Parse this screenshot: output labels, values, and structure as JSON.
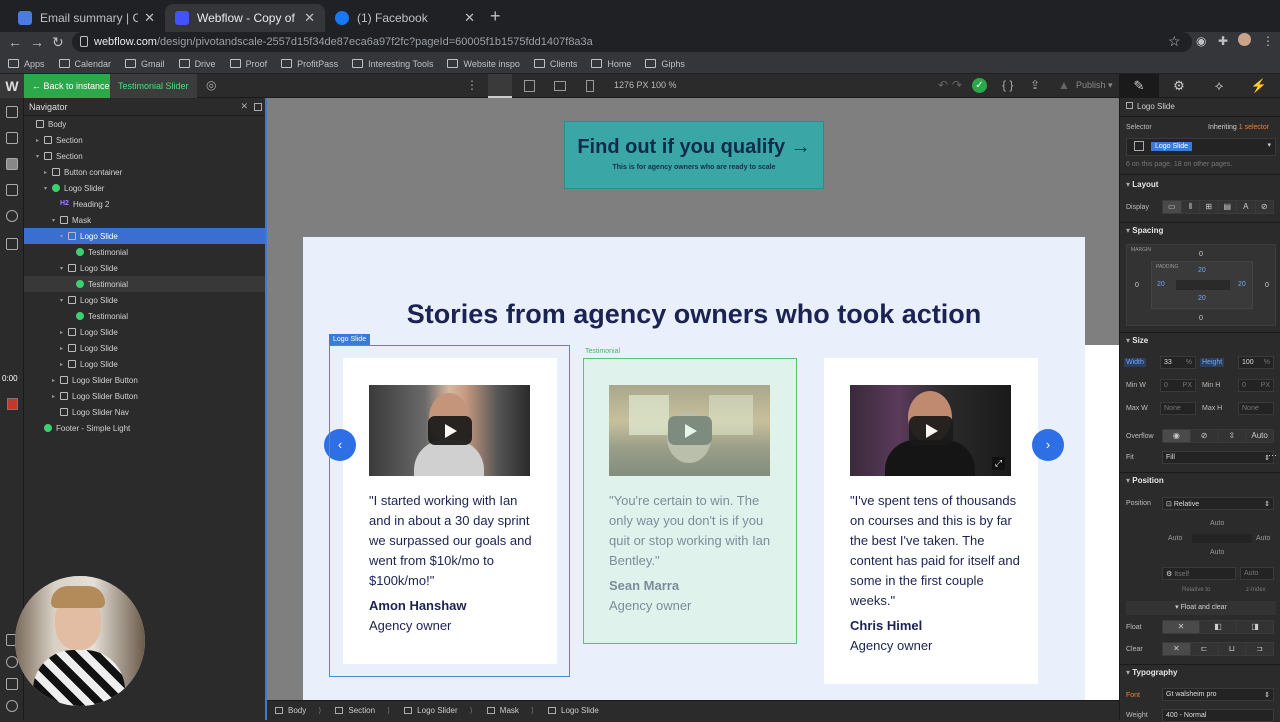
{
  "browser": {
    "tabs": [
      {
        "title": "Email summary | Conversion A",
        "favicon_color": "#4a7ce0"
      },
      {
        "title": "Webflow - Copy of Pivot and S",
        "favicon_color": "#4353ff"
      },
      {
        "title": "(1) Facebook",
        "favicon_color": "#1877f2"
      }
    ],
    "url_host": "webflow.com",
    "url_path": "/design/pivotandscale-2557d15f34de87eca6a97f2fc?pageId=60005f1b1575fdd1407f8a3a",
    "bookmarks": [
      "Apps",
      "Calendar",
      "Gmail",
      "Drive",
      "Proof",
      "ProfitPass",
      "Interesting Tools",
      "Website inspo",
      "Clients",
      "Home",
      "Giphs"
    ]
  },
  "toolbar": {
    "logo": "W",
    "back_label": "← Back to instance",
    "symbol_label": "Testimonial Slider",
    "px_readout": "1276 PX   100 %",
    "publish_label": "Publish ▾",
    "accent": "#2ca84b"
  },
  "recording": {
    "timer": "0:00"
  },
  "navigator": {
    "title": "Navigator",
    "items": [
      {
        "label": "Body",
        "indent": 0,
        "icon": "box",
        "caret": ""
      },
      {
        "label": "Section",
        "indent": 1,
        "icon": "section",
        "caret": "▸"
      },
      {
        "label": "Section",
        "indent": 1,
        "icon": "section",
        "caret": "▾"
      },
      {
        "label": "Button container",
        "indent": 2,
        "icon": "box",
        "caret": "▸"
      },
      {
        "label": "Logo Slider",
        "indent": 2,
        "icon": "green",
        "caret": "▾"
      },
      {
        "label": "Heading 2",
        "indent": 3,
        "icon": "h2",
        "caret": ""
      },
      {
        "label": "Mask",
        "indent": 3,
        "icon": "box",
        "caret": "▾"
      },
      {
        "label": "Logo Slide",
        "indent": 4,
        "icon": "box",
        "caret": "▾",
        "selected": true
      },
      {
        "label": "Testimonial",
        "indent": 5,
        "icon": "green",
        "caret": ""
      },
      {
        "label": "Logo Slide",
        "indent": 4,
        "icon": "box",
        "caret": "▾"
      },
      {
        "label": "Testimonial",
        "indent": 5,
        "icon": "green",
        "caret": "",
        "hover": true
      },
      {
        "label": "Logo Slide",
        "indent": 4,
        "icon": "box",
        "caret": "▾"
      },
      {
        "label": "Testimonial",
        "indent": 5,
        "icon": "green",
        "caret": ""
      },
      {
        "label": "Logo Slide",
        "indent": 4,
        "icon": "box",
        "caret": "▸"
      },
      {
        "label": "Logo Slide",
        "indent": 4,
        "icon": "box",
        "caret": "▸"
      },
      {
        "label": "Logo Slide",
        "indent": 4,
        "icon": "box",
        "caret": "▸"
      },
      {
        "label": "Logo Slider Button",
        "indent": 3,
        "icon": "box",
        "caret": "▸"
      },
      {
        "label": "Logo Slider Button",
        "indent": 3,
        "icon": "box",
        "caret": "▸"
      },
      {
        "label": "Logo Slider Nav",
        "indent": 3,
        "icon": "box",
        "caret": ""
      },
      {
        "label": "Footer - Simple Light",
        "indent": 1,
        "icon": "green",
        "caret": ""
      }
    ]
  },
  "canvas": {
    "cta_title": "Find out if you qualify →",
    "cta_subtitle": "This is for agency owners who are ready to scale",
    "heading": "Stories from agency owners who took action",
    "selected_badge": "Logo Slide",
    "testimonial_badge": "Testimonial",
    "prev": "‹",
    "next": "›",
    "cards": [
      {
        "quote": "\"I started working with Ian and in about a 30 day sprint we surpassed our goals and went from $10k/mo to $100k/mo!\"",
        "name": "Amon Hanshaw",
        "role": "Agency owner"
      },
      {
        "quote": "\"You're certain to win. The only way you don't is if you quit or stop working with Ian Bentley.\"",
        "name": "Sean Marra",
        "role": "Agency owner"
      },
      {
        "quote": "\"I've spent tens of thousands on courses and this is by far the best I've taken. The content has paid for itself and some in the first couple weeks.\"",
        "name": "Chris Himel",
        "role": "Agency owner"
      }
    ]
  },
  "breadcrumb": [
    "Body",
    "Section",
    "Logo Slider",
    "Mask",
    "Logo Slide"
  ],
  "style_panel": {
    "element": "Logo Slide",
    "selector_label": "Selector",
    "inheriting": "Inheriting",
    "inheriting_count": "1 selector",
    "selector_chip": "Logo Slide",
    "usage": "6 on this page, 18 on other pages.",
    "layout": "Layout",
    "display": "Display",
    "spacing": "Spacing",
    "margin": "MARGIN",
    "padding": "PADDING",
    "margin_values": {
      "top": "0",
      "right": "0",
      "bottom": "0",
      "left": "0"
    },
    "padding_values": {
      "top": "20",
      "right": "20",
      "bottom": "20",
      "left": "20"
    },
    "size": "Size",
    "width_label": "Width",
    "width": "33",
    "width_unit": "%",
    "height_label": "Height",
    "height": "100",
    "height_unit": "%",
    "minw_label": "Min W",
    "minw": "0",
    "minw_unit": "PX",
    "minh_label": "Min H",
    "minh": "0",
    "minh_unit": "PX",
    "maxw_label": "Max W",
    "maxw": "None",
    "maxh_label": "Max H",
    "maxh": "None",
    "overflow_label": "Overflow",
    "overflow_auto": "Auto",
    "fit_label": "Fit",
    "fit": "Fill",
    "position_section": "Position",
    "position_label": "Position",
    "position": "Relative",
    "pos_top": "Auto",
    "pos_left": "Auto",
    "pos_right": "Auto",
    "pos_bottom": "Auto",
    "itself": "Itself",
    "zauto": "Auto",
    "relative_to": "Relative to",
    "zindex": "z-Index",
    "float_clear": "Float and clear",
    "float_label": "Float",
    "clear_label": "Clear",
    "typography": "Typography",
    "font_label": "Font",
    "font": "Gt walsheim pro",
    "weight_label": "Weight",
    "weight": "400 - Normal",
    "accent_orange": "#e8843c"
  }
}
